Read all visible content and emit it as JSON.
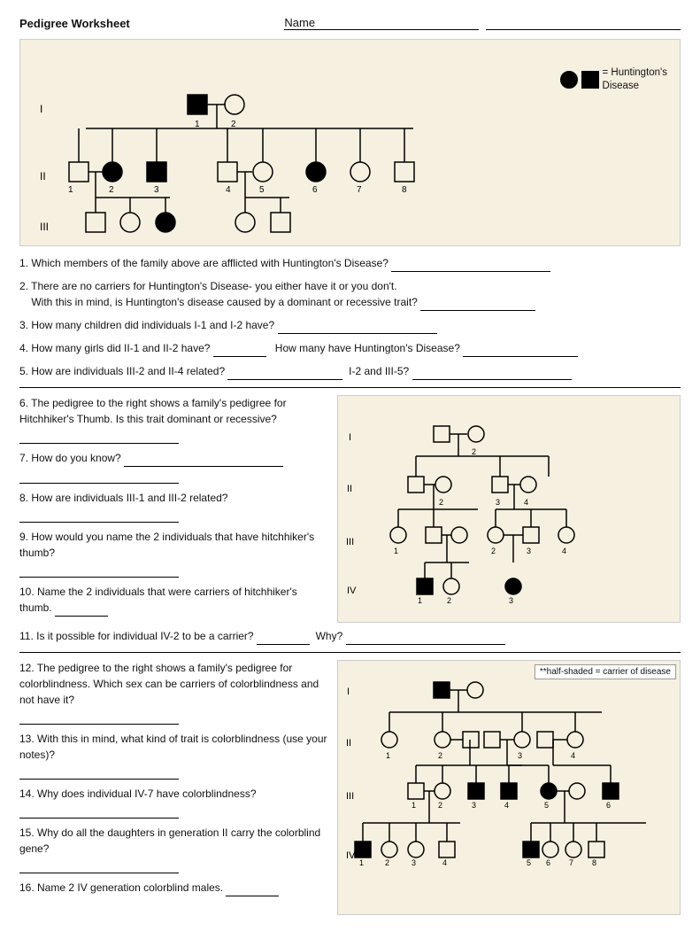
{
  "header": {
    "title": "Pedigree Worksheet",
    "name_label": "Name"
  },
  "legend": {
    "equals": "= Huntington's",
    "disease": "Disease"
  },
  "questions": {
    "q1": "1. Which members of the family above are afflicted with Huntington's Disease?",
    "q2a": "2. There are no carriers for Huntington's Disease- you either have it or you don't.",
    "q2b": "With this in mind, is Huntington's disease caused by a dominant or recessive trait?",
    "q3": "3. How many children did individuals I-1 and I-2 have?",
    "q4a": "4. How many girls did II-1 and II-2 have?",
    "q4b": "How many have Huntington's Disease?",
    "q5a": "5. How are individuals III-2 and II-4 related?",
    "q5b": "I-2 and III-5?",
    "q6": "6. The pedigree to the right shows a family's pedigree for Hitchhiker's Thumb. Is this trait dominant or recessive?",
    "q7": "7. How do you know?",
    "q8": "8. How are individuals III-1 and III-2 related?",
    "q9": "9. How would you name the 2 individuals that have hitchhiker's thumb?",
    "q10": "10. Name the 2 individuals that were carriers of hitchhiker's thumb.",
    "q11a": "11. Is it possible for individual IV-2 to be a carrier?",
    "q11b": "Why?",
    "q12": "12. The pedigree to the right shows a family's pedigree for colorblindness.  Which sex can be carriers of colorblindness and not have it?",
    "q13": "13. With this in mind, what kind of trait is colorblindness (use your notes)?",
    "q14": "14. Why does individual IV-7 have colorblindness?",
    "q15": "15. Why do all the daughters in generation II carry the colorblind gene?",
    "q16": "16. Name 2 IV generation colorblind males.",
    "carrier_note": "**half-shaded = carrier of disease"
  }
}
